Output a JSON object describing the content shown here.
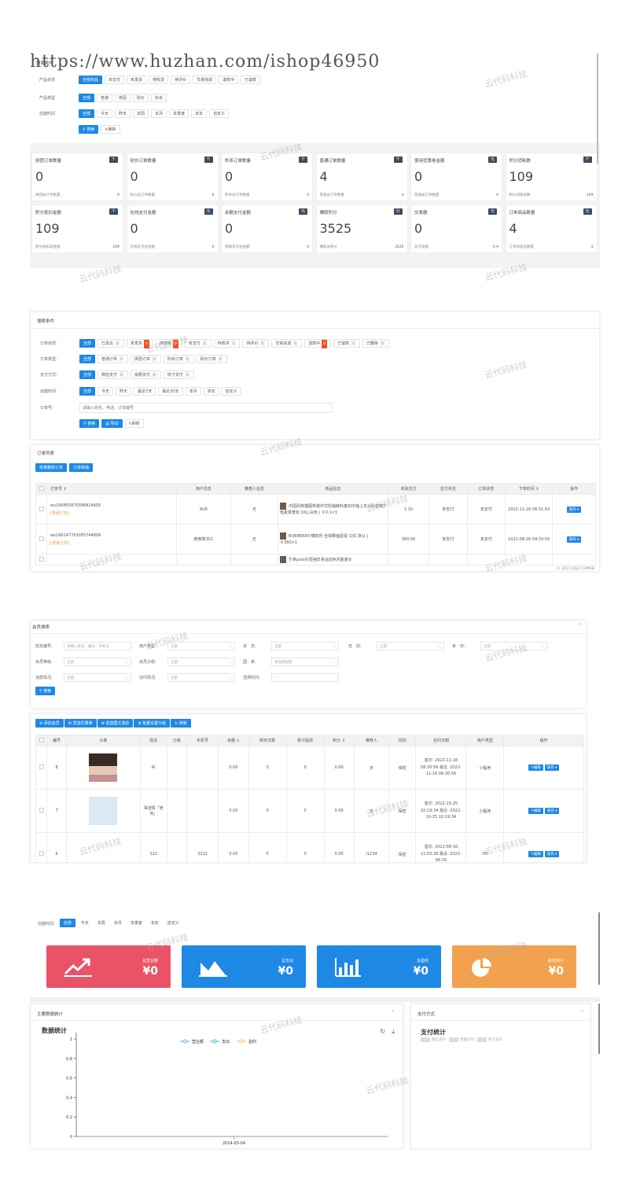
{
  "url_overlay": "https://www.huzhan.com/ishop46950",
  "watermark": "云代码科技",
  "s1": {
    "search_title": "搜索条件",
    "rows": [
      {
        "label": "产品状态",
        "options": [
          "全部商品",
          "未支付",
          "未发货",
          "待收货",
          "待评价",
          "交易完成",
          "退款中",
          "已退款"
        ]
      },
      {
        "label": "产品类型",
        "options": [
          "全部",
          "普通",
          "拼团",
          "砍价",
          "秒杀"
        ]
      },
      {
        "label": "创建时间",
        "options": [
          "全部",
          "今天",
          "昨天",
          "本周",
          "本月",
          "本季度",
          "本年",
          "自定义"
        ]
      }
    ],
    "search_btn": "搜索",
    "refresh_btn": "刷新",
    "cards": [
      {
        "title": "拼团订单数量",
        "tag": "个",
        "value": "0",
        "sub": "拼团总订单数量",
        "subv": "0"
      },
      {
        "title": "砍价订单数量",
        "tag": "个",
        "value": "0",
        "sub": "砍价总订单数量",
        "subv": "0"
      },
      {
        "title": "秒杀订单数量",
        "tag": "个",
        "value": "0",
        "sub": "秒杀总订单数量",
        "subv": "0"
      },
      {
        "title": "普通订单数量",
        "tag": "个",
        "value": "4",
        "sub": "普通总订单数量",
        "subv": "4"
      },
      {
        "title": "使用优惠卷金额",
        "tag": "元",
        "value": "0",
        "sub": "普通总订单数量",
        "subv": "0"
      },
      {
        "title": "积分消耗数",
        "tag": "个",
        "value": "109",
        "sub": "积分消耗总数",
        "subv": "109"
      },
      {
        "title": "积分抵扣金额",
        "tag": "个",
        "value": "109",
        "sub": "积分抵扣总金额",
        "subv": "109"
      },
      {
        "title": "在线支付金额",
        "tag": "元",
        "value": "0",
        "sub": "在线支付总金额",
        "subv": "0"
      },
      {
        "title": "余额支付金额",
        "tag": "元",
        "value": "0",
        "sub": "余额支付总金额",
        "subv": "0"
      },
      {
        "title": "赚取积分",
        "tag": "分",
        "value": "3525",
        "sub": "赚取总积分",
        "subv": "3525"
      },
      {
        "title": "交易额",
        "tag": "元",
        "value": "0",
        "sub": "总交易额",
        "subv": "0 ¥"
      },
      {
        "title": "订单商品数量",
        "tag": "元",
        "value": "4",
        "sub": "订单商品总数量",
        "subv": "4"
      }
    ]
  },
  "s2": {
    "search_title": "搜索条件",
    "order_status_label": "订单状态:",
    "order_status": [
      {
        "t": "全部"
      },
      {
        "t": "已具出",
        "b": "0"
      },
      {
        "t": "未发货",
        "b": "3",
        "r": true
      },
      {
        "t": "待核销",
        "b": "0",
        "r": true
      },
      {
        "t": "未支付",
        "b": "4"
      },
      {
        "t": "待收货",
        "b": "0"
      },
      {
        "t": "待评价",
        "b": "0"
      },
      {
        "t": "交易完成",
        "b": "0"
      },
      {
        "t": "退款中",
        "b": "0",
        "r": true
      },
      {
        "t": "已退款",
        "b": "0"
      },
      {
        "t": "已删除",
        "b": "0"
      }
    ],
    "order_type_label": "订单类型:",
    "order_type": [
      {
        "t": "全部"
      },
      {
        "t": "普通订单",
        "b": "4"
      },
      {
        "t": "拼团订单",
        "b": "0"
      },
      {
        "t": "秒杀订单",
        "b": "0"
      },
      {
        "t": "砍价订单",
        "b": "0"
      }
    ],
    "pay_label": "支付方式:",
    "pay": [
      {
        "t": "全部"
      },
      {
        "t": "微信支付",
        "b": "4"
      },
      {
        "t": "余额支付",
        "b": "0"
      },
      {
        "t": "线下支付",
        "b": "0"
      }
    ],
    "time_label": "创建时间:",
    "time": [
      {
        "t": "全部"
      },
      {
        "t": "今天"
      },
      {
        "t": "昨天"
      },
      {
        "t": "最近7天"
      },
      {
        "t": "最近30天"
      },
      {
        "t": "本月"
      },
      {
        "t": "本年"
      },
      {
        "t": "自定义"
      }
    ],
    "order_no_label": "订单号:",
    "order_no_placeholder": "请输入姓名、电话、订单编号",
    "search_btn": "搜索",
    "export_btn": "导出",
    "refresh_btn": "刷新",
    "list_title": "订单列表",
    "bulk_delete": "批量删除订单",
    "order_verify": "订单核销",
    "headers": [
      "订单号 ⇕",
      "用户信息",
      "推荐人信息",
      "商品信息",
      "实际支付",
      "支付状态",
      "订单状态",
      "下单时间 ⇕",
      "操作"
    ],
    "rows": [
      {
        "no": "wx166855870396814605",
        "type": "[普通订单]",
        "user": "AI/8",
        "ref": "无",
        "goods": "中国风熊猫图男装中式短袖麻料盘扣中袖上衣大码亚麻T恤夏季宽松 XXL,白色 | ￥0.1×1",
        "pay": "1.10",
        "ps": "未支付",
        "os": "未支付",
        "time": "2022-11-16 08:31:43",
        "op": "操作"
      },
      {
        "no": "wx166147763055744806",
        "type": "[普通订单]",
        "user": "用用简书/1",
        "ref": "无",
        "goods": "BURBERRY/博柏利 丝绒雾面唇膏 口红 默认 | ￥360×1",
        "pay": "360.00",
        "ps": "未支付",
        "os": "未支付",
        "time": "2022-08-26 09:33:50",
        "op": "操作"
      },
      {
        "no": "",
        "type": "",
        "user": "",
        "ref": "",
        "goods": "尔世polo衫短袖日系运动休闲夏装女",
        "pay": "",
        "ps": "",
        "os": "",
        "time": "",
        "op": ""
      }
    ],
    "footer": "© 2017-2021 CRMEB"
  },
  "s3": {
    "title": "会员搜索",
    "f1": {
      "label": "姓名编号:",
      "ph": "请输入姓名、编号、手机号"
    },
    "f2": {
      "label": "用户类型:",
      "ph": "全部"
    },
    "f3": {
      "label": "状　态:",
      "ph": "全部"
    },
    "f4": {
      "label": "性　别:",
      "ph": "全部"
    },
    "f5": {
      "label": "身　份:",
      "ph": "全部"
    },
    "f6": {
      "label": "会员等级:",
      "ph": "全部"
    },
    "f7": {
      "label": "会员分组:",
      "ph": "全部"
    },
    "f8": {
      "label": "国　家:",
      "ph": "请选择国家"
    },
    "f9": {
      "label": "消费情况:",
      "ph": "全部"
    },
    "f10": {
      "label": "访问情况:",
      "ph": "全部"
    },
    "f11": {
      "label": "选择时间:",
      "ph": "-"
    },
    "search_btn": "搜索",
    "actions": [
      "添加会员",
      "发送优惠券",
      "发送图文消息",
      "批量设置分组",
      "刷新"
    ],
    "headers": [
      "编号",
      "头像",
      "姓名",
      "分组",
      "手机号",
      "余额 ⇕",
      "购买次数",
      "累计提现",
      "积分 ⇕",
      "推荐人",
      "性别",
      "访问日期",
      "用户类型",
      "操作"
    ],
    "rows": [
      {
        "id": "8",
        "name": "AI",
        "group": "",
        "phone": "",
        "bal": "0.00",
        "buy": "0",
        "wd": "0",
        "pts": "0.00",
        "ref": "无",
        "sex": "保密",
        "visit": "首次: 2022-11-16 08:30:56 最近: 2022-11-16 08:30:56",
        "type": "小程序"
      },
      {
        "id": "7",
        "name": "事迹情「老何」",
        "group": "",
        "phone": "",
        "bal": "0.00",
        "buy": "0",
        "wd": "0",
        "pts": "0.00",
        "ref": "无",
        "sex": "保密",
        "visit": "首次: 2022-10-25 10:19:34 最近: 2022-10-25 10:19:34",
        "type": "小程序"
      },
      {
        "id": "6",
        "name": "222",
        "group": "",
        "phone": "2222",
        "bal": "0.00",
        "buy": "0",
        "wd": "0",
        "pts": "0.00",
        "ref": "/1234",
        "sex": "保密",
        "visit": "首次: 2022-08-16 11:03:28 最近: 2022-08-16",
        "type": "H5"
      }
    ],
    "edit": "编辑",
    "op": "操作"
  },
  "s4": {
    "time_label": "创建时间:",
    "time": [
      "全部",
      "今天",
      "本周",
      "本月",
      "本季度",
      "本年",
      "自定义"
    ],
    "stats": [
      {
        "title": "总营业额",
        "value": "¥0",
        "color": "#ea5367"
      },
      {
        "title": "总支出",
        "value": "¥0",
        "color": "#1e88e5"
      },
      {
        "title": "总盈利",
        "value": "¥0",
        "color": "#1e88e5"
      },
      {
        "title": "新增用户",
        "value": "¥0",
        "color": "#f2a24e"
      }
    ],
    "main_panel": "主要数据统计",
    "chart_title": "数据统计",
    "pay_panel": "支付方式",
    "pay_title": "支付统计",
    "pay_legend": [
      "微信支付",
      "余额支付",
      "线下支付"
    ]
  },
  "chart_data": {
    "type": "line",
    "title": "数据统计",
    "series": [
      {
        "name": "营业额",
        "values": [
          0
        ],
        "color": "#5ab1ef"
      },
      {
        "name": "支出",
        "values": [
          0
        ],
        "color": "#2ec7c9"
      },
      {
        "name": "盈利",
        "values": [
          0
        ],
        "color": "#ffb980"
      }
    ],
    "x": [
      "2024-03-04"
    ],
    "yticks": [
      "0",
      "0.2",
      "0.4",
      "0.6",
      "0.8",
      "1"
    ],
    "ylim": [
      0,
      1
    ]
  }
}
